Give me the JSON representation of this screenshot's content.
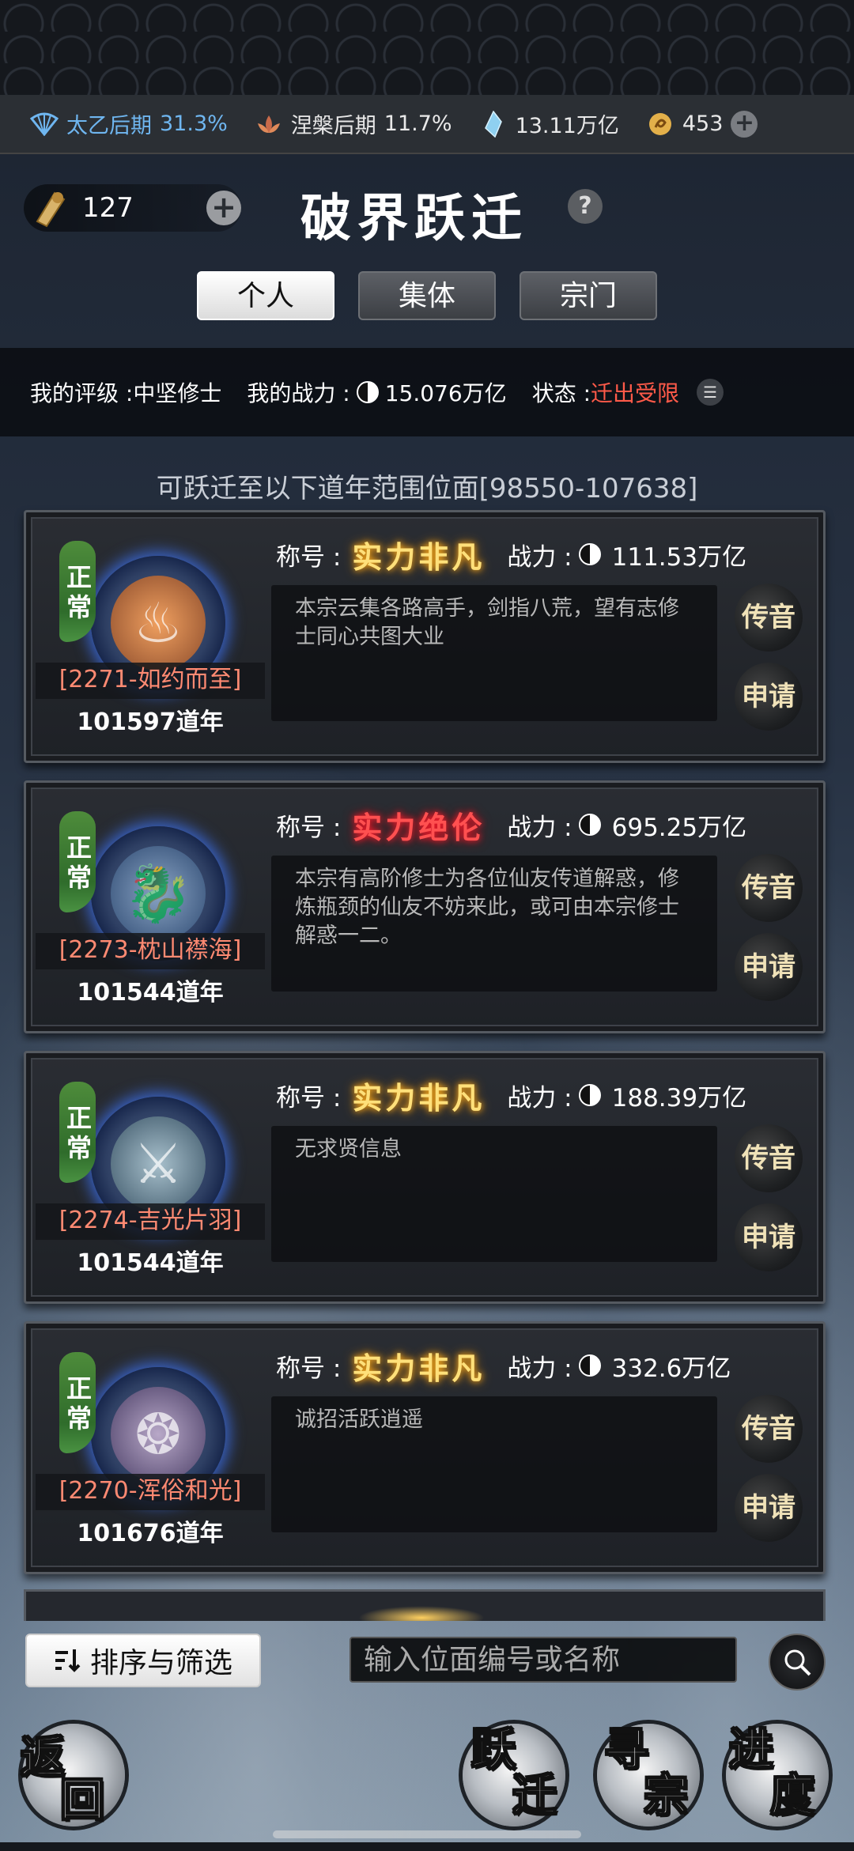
{
  "resources": {
    "cultivation1": {
      "label": "太乙后期",
      "value": "31.3%",
      "icon": "fan-icon"
    },
    "cultivation2": {
      "label": "涅槃后期",
      "value": "11.7%",
      "icon": "lotus-icon"
    },
    "spirit_stone": {
      "value": "13.11万亿",
      "icon": "crystal-icon"
    },
    "gold": {
      "value": "453",
      "icon": "coin-icon"
    },
    "add_icon": "plus-icon"
  },
  "header": {
    "token_value": "127",
    "title": "破界跃迁",
    "help": "?"
  },
  "tabs": [
    {
      "label": "个人",
      "active": true
    },
    {
      "label": "集体",
      "active": false
    },
    {
      "label": "宗门",
      "active": false
    }
  ],
  "status": {
    "rating_label": "我的评级 : ",
    "rating_value": "中坚修士",
    "power_label": "我的战力 : ",
    "power_value": "15.076万亿",
    "state_label": "状态 : ",
    "state_value": "迁出受限"
  },
  "range_text": "可跃迁至以下道年范围位面[98550-107638]",
  "labels": {
    "title_label": "称号 : ",
    "power_label": "战力 : ",
    "seal": "正常",
    "transmit": "传音",
    "apply": "申请"
  },
  "sects": [
    {
      "name": "[2271-如约而至]",
      "year": "101597道年",
      "rank": "实力非凡",
      "rank_color": "gold",
      "power": "111.53万亿",
      "desc": "本宗云集各路高手，剑指八荒，望有志修士同心共图大业",
      "emblem": "flame-emblem"
    },
    {
      "name": "[2273-枕山襟海]",
      "year": "101544道年",
      "rank": "实力绝伦",
      "rank_color": "red",
      "power": "695.25万亿",
      "desc": "本宗有高阶修士为各位仙友传道解惑，修炼瓶颈的仙友不妨来此，或可由本宗修士解惑一二。",
      "emblem": "beast-emblem"
    },
    {
      "name": "[2274-吉光片羽]",
      "year": "101544道年",
      "rank": "实力非凡",
      "rank_color": "gold",
      "power": "188.39万亿",
      "desc": "无求贤信息",
      "emblem": "sword-emblem"
    },
    {
      "name": "[2270-浑俗和光]",
      "year": "101676道年",
      "rank": "实力非凡",
      "rank_color": "gold",
      "power": "332.6万亿",
      "desc": "诚招活跃逍遥",
      "emblem": "phoenix-emblem"
    }
  ],
  "bottom": {
    "sort_label": "排序与筛选",
    "search_placeholder": "输入位面编号或名称",
    "back_1": "返",
    "back_2": "回",
    "jump_1": "跃",
    "jump_2": "迁",
    "seek_1": "寻",
    "seek_2": "宗",
    "progress_1": "进",
    "progress_2": "度"
  },
  "colors": {
    "accent_blue": "#6fb6f0",
    "state_red": "#ff5a49",
    "sect_name": "#ff8a72",
    "rank_gold": "#ffe07a",
    "rank_red": "#ff5050"
  }
}
